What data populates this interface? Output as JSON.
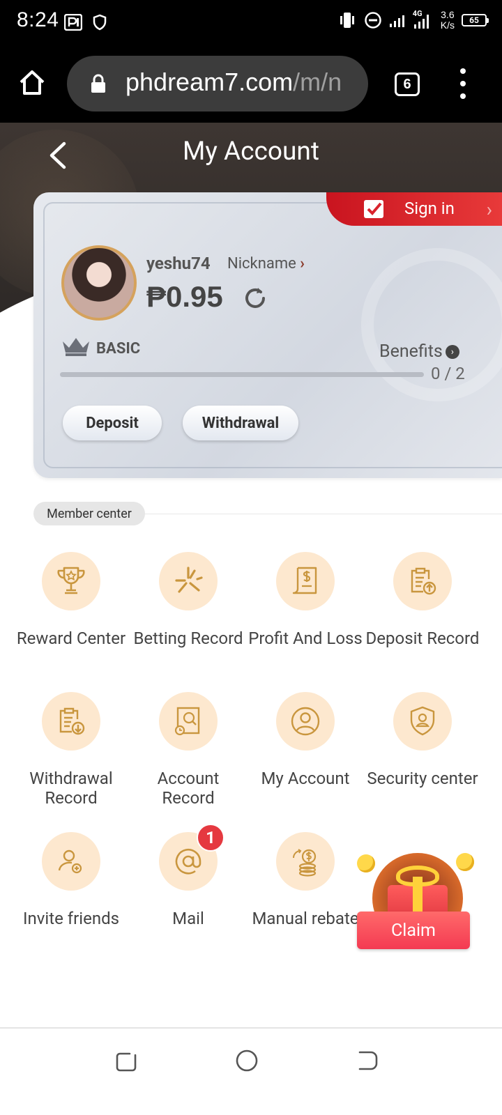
{
  "status_bar": {
    "time": "8:24",
    "net_speed_value": "3.6",
    "net_speed_unit": "K/s",
    "network": "4G",
    "battery": "65"
  },
  "browser": {
    "url_host": "phdream7.com",
    "url_path": "/m/n",
    "tab_count": "6"
  },
  "header": {
    "title": "My Account"
  },
  "account_card": {
    "sign_in_label": "Sign in",
    "username": "yeshu74",
    "nickname_label": "Nickname",
    "balance": "₱0.95",
    "vip_level": "BASIC",
    "benefits_label": "Benefits",
    "progress_text": "0 / 2",
    "progress_fraction": 0,
    "deposit_label": "Deposit",
    "withdrawal_label": "Withdrawal"
  },
  "member_center": {
    "section_label": "Member center",
    "items": [
      {
        "label": "Reward Center",
        "icon": "trophy-icon"
      },
      {
        "label": "Betting Record",
        "icon": "betting-record-icon"
      },
      {
        "label": "Profit And Loss",
        "icon": "receipt-dollar-icon"
      },
      {
        "label": "Deposit Record",
        "icon": "clipboard-upload-icon"
      },
      {
        "label": "Withdrawal Record",
        "icon": "clipboard-download-icon"
      },
      {
        "label": "Account Record",
        "icon": "account-record-icon"
      },
      {
        "label": "My Account",
        "icon": "user-circle-icon"
      },
      {
        "label": "Security center",
        "icon": "shield-user-icon"
      },
      {
        "label": "Invite friends",
        "icon": "add-user-icon"
      },
      {
        "label": "Mail",
        "icon": "at-sign-icon",
        "badge": "1"
      },
      {
        "label": "Manual rebate",
        "icon": "coins-icon"
      }
    ]
  },
  "claim": {
    "label": "Claim"
  },
  "colors": {
    "accent_gold": "#d5a25c",
    "icon_bg": "#fde8cf",
    "sign_in_red": "#d9232d",
    "badge_red": "#e53940"
  }
}
